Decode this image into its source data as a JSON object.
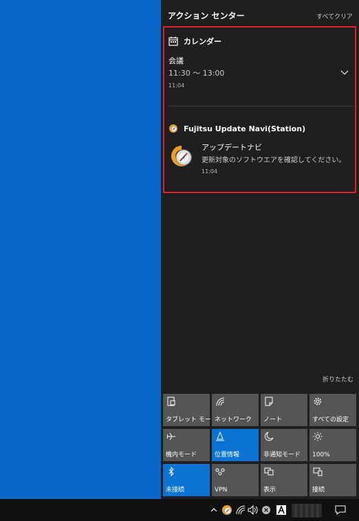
{
  "action_center": {
    "title": "アクション センター",
    "clear_all": "すべてクリア",
    "collapse": "折りたたむ"
  },
  "notifications": {
    "calendar": {
      "app_name": "カレンダー",
      "icon": "calendar-icon",
      "title": "会議",
      "body": "11:30 ～ 13:00",
      "time": "11:04"
    },
    "fujitsu": {
      "app_name": "Fujitsu Update Navi(Station)",
      "icon": "update-navi-icon",
      "title": "アップデートナビ",
      "body": "更新対象のソフトウエアを確認してください。",
      "time": "11:04"
    }
  },
  "quick_actions": [
    {
      "label": "タブレット モード",
      "icon": "tablet-mode-icon",
      "active": false
    },
    {
      "label": "ネットワーク",
      "icon": "network-icon",
      "active": false
    },
    {
      "label": "ノート",
      "icon": "note-icon",
      "active": false
    },
    {
      "label": "すべての設定",
      "icon": "gear-icon",
      "active": false
    },
    {
      "label": "機内モード",
      "icon": "airplane-icon",
      "active": false
    },
    {
      "label": "位置情報",
      "icon": "location-icon",
      "active": true
    },
    {
      "label": "非通知モード",
      "icon": "moon-icon",
      "active": false
    },
    {
      "label": "100%",
      "icon": "brightness-icon",
      "active": false
    },
    {
      "label": "未接続",
      "icon": "bluetooth-icon",
      "active": true
    },
    {
      "label": "VPN",
      "icon": "vpn-icon",
      "active": false
    },
    {
      "label": "表示",
      "icon": "project-icon",
      "active": false
    },
    {
      "label": "接続",
      "icon": "connect-icon",
      "active": false
    }
  ],
  "colors": {
    "accent": "#0a74d4",
    "highlight_border": "#e0202a",
    "panel_bg": "#1f1f1f",
    "tile_bg": "#555555"
  }
}
